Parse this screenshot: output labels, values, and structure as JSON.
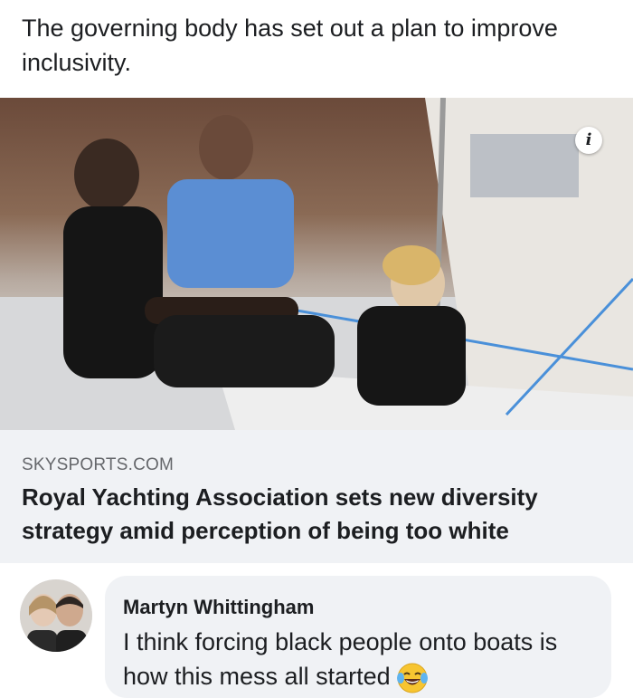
{
  "post": {
    "text": "The governing body has set out a plan to improve inclusivity."
  },
  "link_preview": {
    "info_icon_glyph": "i",
    "domain": "SKYSPORTS.COM",
    "title": "Royal Yachting Association sets new diversity strategy amid perception of being too white"
  },
  "comment": {
    "author": "Martyn Whittingham",
    "text": "I think forcing black people onto boats is how this mess all started",
    "emoji_icon": "face-with-tears-of-joy-icon"
  },
  "colors": {
    "background": "#ffffff",
    "link_box": "#f0f2f5",
    "bubble": "#f0f2f5",
    "domain_text": "#65676b",
    "primary_text": "#1c1e21"
  }
}
